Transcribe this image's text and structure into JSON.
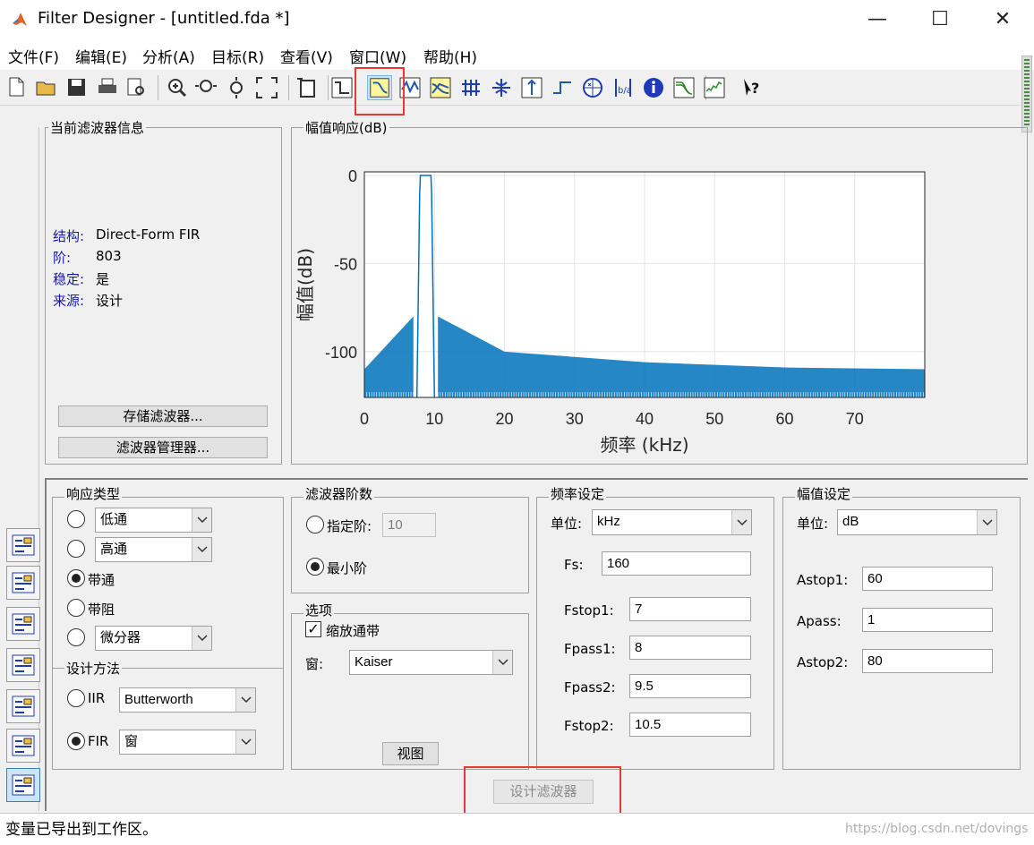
{
  "window": {
    "title": "Filter Designer -  [untitled.fda *]",
    "min": "—",
    "max": "☐",
    "close": "✕"
  },
  "menu": [
    "文件(F)",
    "编辑(E)",
    "分析(A)",
    "目标(R)",
    "查看(V)",
    "窗口(W)",
    "帮助(H)"
  ],
  "toolbar": {
    "icons": [
      "new-file-icon",
      "open-folder-icon",
      "save-icon",
      "print-icon",
      "print-preview-icon",
      "zoom-in-icon",
      "zoom-x-icon",
      "zoom-y-icon",
      "full-view-icon",
      "new-figure-icon",
      "filter-specs-icon",
      "magnitude-response-icon",
      "phase-response-icon",
      "magnitude-phase-icon",
      "group-delay-icon",
      "phase-delay-icon",
      "impulse-response-icon",
      "step-response-icon",
      "pole-zero-icon",
      "filter-coefficients-icon",
      "filter-info-icon",
      "magnitude-estimate-icon",
      "round-off-noise-icon",
      "whats-this-icon"
    ],
    "active": "magnitude-response-icon"
  },
  "info_panel": {
    "title": "当前滤波器信息",
    "rows": [
      {
        "key": "结构:",
        "value": "Direct-Form FIR"
      },
      {
        "key": "阶:",
        "value": "803"
      },
      {
        "key": "稳定:",
        "value": "是"
      },
      {
        "key": "来源:",
        "value": "设计"
      }
    ],
    "store_button": "存储滤波器...",
    "manager_button": "滤波器管理器..."
  },
  "plot_panel": {
    "title": "幅值响应(dB)"
  },
  "chart_data": {
    "type": "line",
    "title": "",
    "xlabel": "频率 (kHz)",
    "ylabel": "幅值(dB)",
    "xlim": [
      0,
      80
    ],
    "ylim": [
      -126,
      2
    ],
    "x_ticks": [
      "0",
      "10",
      "20",
      "30",
      "40",
      "50",
      "60",
      "70"
    ],
    "y_ticks": [
      "0",
      "-50",
      "-100"
    ],
    "x_tick_values": [
      0,
      10,
      20,
      30,
      40,
      50,
      60,
      70
    ],
    "y_tick_values": [
      0,
      -50,
      -100
    ],
    "grid": true,
    "line_color": "#0072bd",
    "series": [
      {
        "x": [
          7.5,
          7.9,
          8.0,
          9.5,
          9.6,
          10.0
        ],
        "y": [
          -126,
          -10,
          0,
          0,
          -10,
          -126
        ]
      }
    ],
    "sidelobe_envelope": {
      "lower_band": {
        "x": [
          0,
          7.0
        ],
        "y": [
          -110,
          -80
        ]
      },
      "upper_band": {
        "x": [
          10.5,
          20,
          40,
          60,
          80
        ],
        "y": [
          -80,
          -100,
          -106,
          -109,
          -110
        ]
      }
    }
  },
  "response_type": {
    "title": "响应类型",
    "options": [
      {
        "label": "低通",
        "select": true,
        "checked": false
      },
      {
        "label": "高通",
        "select": true,
        "checked": false
      },
      {
        "label": "带通",
        "select": false,
        "checked": true
      },
      {
        "label": "带阻",
        "select": false,
        "checked": false
      },
      {
        "label": "微分器",
        "select": true,
        "checked": false
      }
    ]
  },
  "design_method": {
    "title": "设计方法",
    "iir_label": "IIR",
    "iir_value": "Butterworth",
    "fir_label": "FIR",
    "fir_value": "窗",
    "fir_checked": true
  },
  "filter_order": {
    "title": "滤波器阶数",
    "specify_label": "指定阶:",
    "specify_value": "10",
    "min_label": "最小阶"
  },
  "options": {
    "title": "选项",
    "scale_label": "缩放通带",
    "scale_checked": true,
    "window_label": "窗:",
    "window_value": "Kaiser",
    "view_button": "视图"
  },
  "freq_spec": {
    "title": "频率设定",
    "unit_label": "单位:",
    "unit_value": "kHz",
    "fields": [
      {
        "label": "Fs:",
        "value": "160"
      },
      {
        "label": "Fstop1:",
        "value": "7"
      },
      {
        "label": "Fpass1:",
        "value": "8"
      },
      {
        "label": "Fpass2:",
        "value": "9.5"
      },
      {
        "label": "Fstop2:",
        "value": "10.5"
      }
    ]
  },
  "mag_spec": {
    "title": "幅值设定",
    "unit_label": "单位:",
    "unit_value": "dB",
    "fields": [
      {
        "label": "Astop1:",
        "value": "60"
      },
      {
        "label": "Apass:",
        "value": "1"
      },
      {
        "label": "Astop2:",
        "value": "80"
      }
    ]
  },
  "design_button": "设计滤波器",
  "status": "变量已导出到工作区。",
  "watermark": "https://blog.csdn.net/dovings",
  "accent_red": "#e53935"
}
